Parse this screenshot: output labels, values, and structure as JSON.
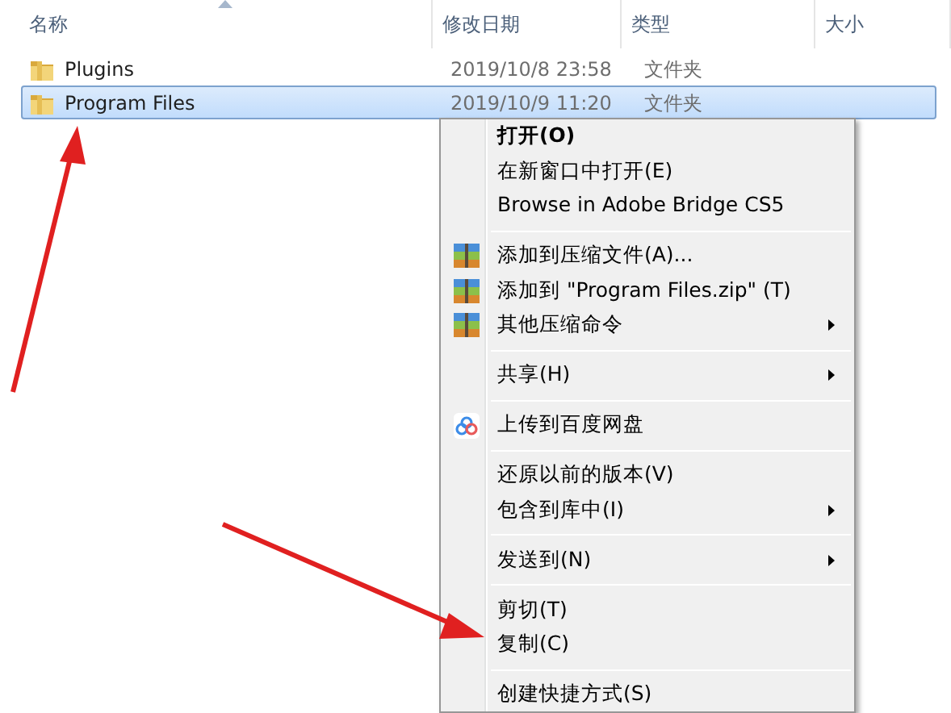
{
  "columns": [
    {
      "label": "名称",
      "sorted": true
    },
    {
      "label": "修改日期",
      "sorted": false
    },
    {
      "label": "类型",
      "sorted": false
    },
    {
      "label": "大小",
      "sorted": false
    }
  ],
  "files": [
    {
      "name": "Plugins",
      "date": "2019/10/8 23:58",
      "type": "文件夹",
      "selected": false
    },
    {
      "name": "Program Files",
      "date": "2019/10/9 11:20",
      "type": "文件夹",
      "selected": true
    }
  ],
  "context_menu": [
    {
      "kind": "item",
      "label": "打开(O)",
      "bold": true
    },
    {
      "kind": "item",
      "label": "在新窗口中打开(E)"
    },
    {
      "kind": "item",
      "label": "Browse in Adobe Bridge CS5"
    },
    {
      "kind": "separator"
    },
    {
      "kind": "archive",
      "label": "添加到压缩文件(A)..."
    },
    {
      "kind": "archive",
      "label": "添加到 \"Program Files.zip\" (T)"
    },
    {
      "kind": "archive",
      "label": "其他压缩命令",
      "submenu": true
    },
    {
      "kind": "separator"
    },
    {
      "kind": "item",
      "label": "共享(H)",
      "submenu": true
    },
    {
      "kind": "separator"
    },
    {
      "kind": "cloud",
      "label": "上传到百度网盘"
    },
    {
      "kind": "separator"
    },
    {
      "kind": "item",
      "label": "还原以前的版本(V)"
    },
    {
      "kind": "item",
      "label": "包含到库中(I)",
      "submenu": true
    },
    {
      "kind": "separator"
    },
    {
      "kind": "item",
      "label": "发送到(N)",
      "submenu": true
    },
    {
      "kind": "separator"
    },
    {
      "kind": "item",
      "label": "剪切(T)"
    },
    {
      "kind": "item",
      "label": "复制(C)"
    },
    {
      "kind": "separator"
    },
    {
      "kind": "item",
      "label": "创建快捷方式(S)"
    }
  ]
}
